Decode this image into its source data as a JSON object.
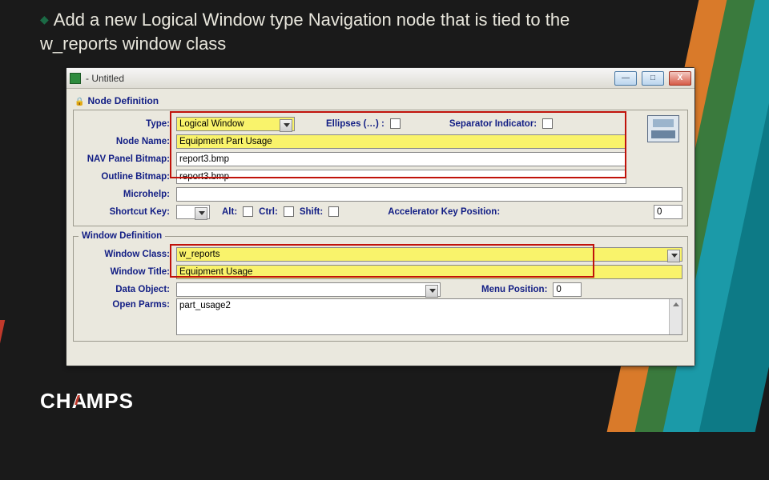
{
  "slide": {
    "bullet": "Add a new Logical Window type Navigation node that is tied to the w_reports window class",
    "logo": "CH MPS"
  },
  "window": {
    "title": " - Untitled",
    "btn_min": "—",
    "btn_max": "□",
    "btn_close": "X"
  },
  "node_def": {
    "section": "Node Definition",
    "type_lbl": "Type:",
    "type_val": "Logical Window",
    "ellipses_lbl": "Ellipses (…) :",
    "separator_lbl": "Separator Indicator:",
    "node_name_lbl": "Node Name:",
    "node_name_val": "Equipment Part Usage",
    "nav_bmp_lbl": "NAV Panel Bitmap:",
    "nav_bmp_val": "report3.bmp",
    "outline_bmp_lbl": "Outline Bitmap:",
    "outline_bmp_val": "report3.bmp",
    "microhelp_lbl": "Microhelp:",
    "shortcut_lbl": "Shortcut Key:",
    "alt_lbl": "Alt:",
    "ctrl_lbl": "Ctrl:",
    "shift_lbl": "Shift:",
    "accel_lbl": "Accelerator Key Position:",
    "accel_val": "0"
  },
  "win_def": {
    "legend": "Window Definition",
    "class_lbl": "Window Class:",
    "class_val": "w_reports",
    "title_lbl": "Window Title:",
    "title_val": "Equipment Usage",
    "data_obj_lbl": "Data Object:",
    "menu_pos_lbl": "Menu Position:",
    "menu_pos_val": "0",
    "open_parms_lbl": "Open Parms:",
    "open_parms_val": "part_usage2"
  }
}
